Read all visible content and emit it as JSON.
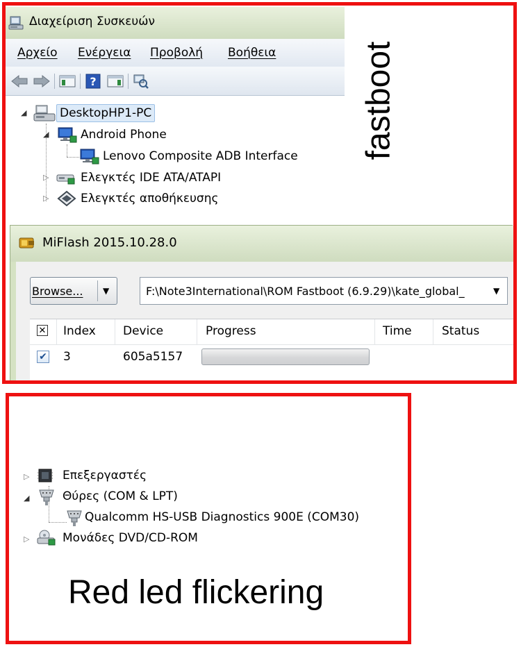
{
  "device_manager": {
    "title": "Διαχείριση Συσκευών",
    "menu": [
      "Αρχείο",
      "Ενέργεια",
      "Προβολή",
      "Βοήθεια"
    ],
    "tree": {
      "root": "DesktopHP1-PC",
      "items": [
        {
          "label": "Android Phone",
          "children": [
            "Lenovo Composite ADB Interface"
          ]
        },
        {
          "label": "Ελεγκτές IDE ATA/ATAPI"
        },
        {
          "label": "Ελεγκτές αποθήκευσης"
        }
      ]
    }
  },
  "annotation_top": "fastboot",
  "miflash": {
    "title": "MiFlash 2015.10.28.0",
    "browse_label": "Browse...",
    "path_value": "F:\\Note3International\\ROM Fastboot (6.9.29)\\kate_global_",
    "columns": [
      "Index",
      "Device",
      "Progress",
      "Time",
      "Status"
    ],
    "rows": [
      {
        "index": "3",
        "device": "605a5157",
        "progress": 0,
        "time": "",
        "status": ""
      }
    ]
  },
  "tree_bottom": {
    "items": [
      {
        "label": "Επεξεργαστές"
      },
      {
        "label": "Θύρες (COM & LPT)",
        "children": [
          "Qualcomm HS-USB Diagnostics 900E (COM30)"
        ]
      },
      {
        "label": "Μονάδες DVD/CD-ROM"
      }
    ]
  },
  "annotation_bottom": "Red led flickering"
}
